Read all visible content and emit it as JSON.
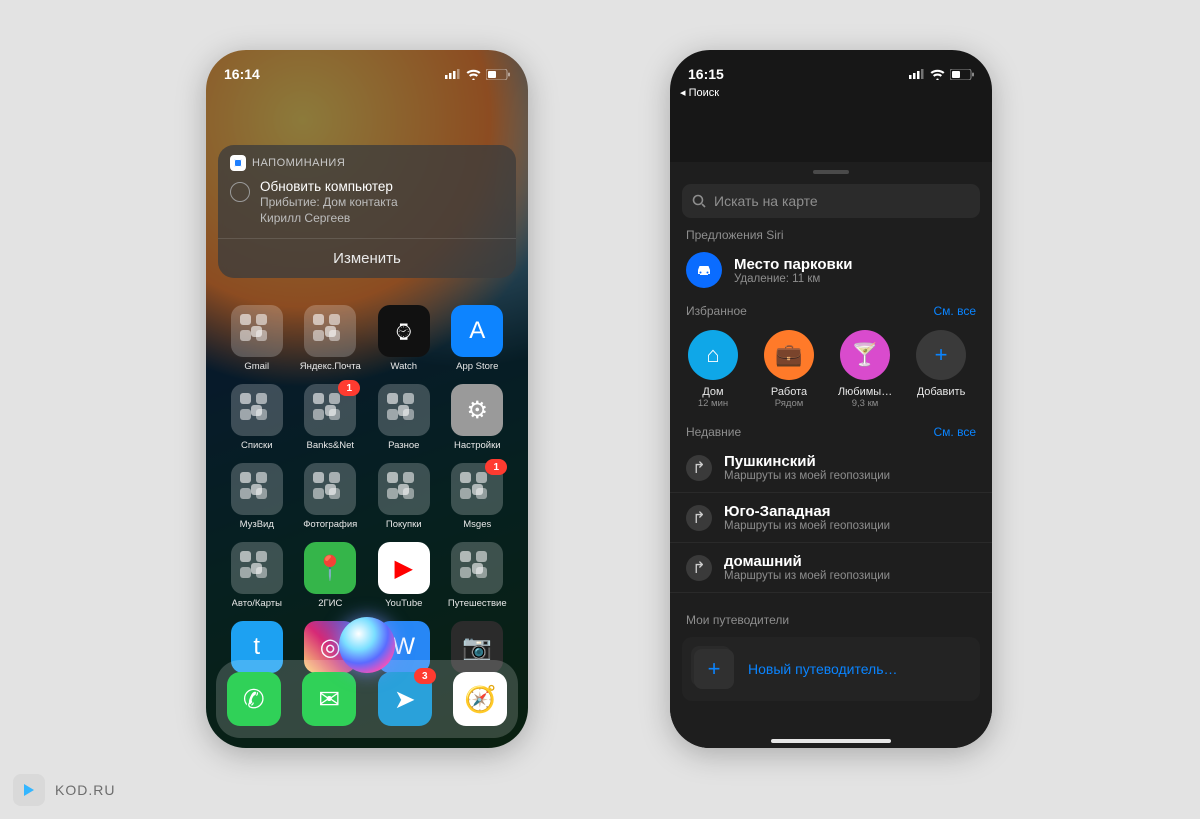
{
  "watermark": "KOD.RU",
  "left": {
    "status": {
      "time": "16:14"
    },
    "notif": {
      "app": "НАПОМИНАНИЯ",
      "title": "Обновить компьютер",
      "line1": "Прибытие: Дом контакта",
      "line2": "Кирилл Сергеев",
      "action": "Изменить"
    },
    "apps": [
      {
        "name": "Gmail",
        "type": "fold"
      },
      {
        "name": "Яндекс.Почта",
        "type": "fold"
      },
      {
        "name": "Watch",
        "bg": "#111",
        "glyph": "⌚︎"
      },
      {
        "name": "App Store",
        "bg": "#0d84ff",
        "glyph": "A"
      },
      {
        "name": "Списки",
        "type": "fold"
      },
      {
        "name": "Banks&Net",
        "type": "fold",
        "badge": "1"
      },
      {
        "name": "Разное",
        "type": "fold"
      },
      {
        "name": "Настройки",
        "bg": "#9a9a9a",
        "glyph": "⚙︎"
      },
      {
        "name": "МузВид",
        "type": "fold"
      },
      {
        "name": "Фотография",
        "type": "fold"
      },
      {
        "name": "Покупки",
        "type": "fold"
      },
      {
        "name": "Msges",
        "type": "fold",
        "badge": "1"
      },
      {
        "name": "Авто/Карты",
        "type": "fold"
      },
      {
        "name": "2ГИС",
        "bg": "#35b54a",
        "glyph": "📍"
      },
      {
        "name": "YouTube",
        "bg": "#fff",
        "glyph": "▶",
        "fg": "#ff0000"
      },
      {
        "name": "Путешествие",
        "type": "fold"
      },
      {
        "name": "Twitter",
        "bg": "#1da1f2",
        "glyph": "t"
      },
      {
        "name": "Instagram",
        "bg": "linear-gradient(45deg,#feda75,#d62976,#4f5bd5)",
        "glyph": "◎"
      },
      {
        "name": "VK",
        "bg": "#2787f5",
        "glyph": "W"
      },
      {
        "name": "Камера",
        "bg": "#2b2b2b",
        "glyph": "📷"
      }
    ],
    "dock": [
      {
        "name": "phone",
        "bg": "#30d158",
        "glyph": "✆"
      },
      {
        "name": "messages",
        "bg": "#30d158",
        "glyph": "✉︎"
      },
      {
        "name": "telegram",
        "bg": "#2aa1da",
        "glyph": "➤",
        "badge": "3"
      },
      {
        "name": "safari",
        "bg": "#fff",
        "glyph": "🧭"
      }
    ]
  },
  "right": {
    "status": {
      "time": "16:15",
      "back": "◂ Поиск"
    },
    "search_placeholder": "Искать на карте",
    "siri_header": "Предложения Siri",
    "parking": {
      "title": "Место парковки",
      "sub": "Удаление: 11 км"
    },
    "fav_header": "Избранное",
    "see_all": "См. все",
    "favorites": [
      {
        "label": "Дом",
        "detail": "12 мин",
        "bg": "#0fa7e8",
        "glyph": "⌂"
      },
      {
        "label": "Работа",
        "detail": "Рядом",
        "bg": "#ff7a29",
        "glyph": "💼"
      },
      {
        "label": "Любимы…",
        "detail": "9,3 км",
        "bg": "#d94bcd",
        "glyph": "🍸"
      },
      {
        "label": "Добавить",
        "detail": "",
        "bg": "#3a3a3a",
        "glyph": "+",
        "fg": "#0a84ff"
      }
    ],
    "recent_header": "Недавние",
    "recent": [
      {
        "title": "Пушкинский",
        "sub": "Маршруты из моей геопозиции"
      },
      {
        "title": "Юго-Западная",
        "sub": "Маршруты из моей геопозиции"
      },
      {
        "title": "домашний",
        "sub": "Маршруты из моей геопозиции"
      }
    ],
    "guides_header": "Мои путеводители",
    "guide_new": "Новый путеводитель…"
  }
}
